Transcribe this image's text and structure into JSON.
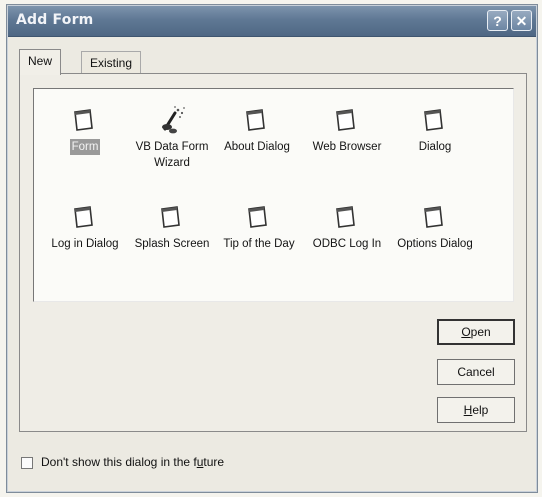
{
  "window": {
    "title": "Add Form",
    "help_glyph": "?",
    "close_glyph": "✕"
  },
  "tabs": [
    {
      "label": "New",
      "active": true
    },
    {
      "label": "Existing",
      "active": false
    }
  ],
  "items": [
    {
      "label": "Form",
      "icon": "form-icon",
      "selected": true
    },
    {
      "label": "VB Data Form Wizard",
      "icon": "wizard-icon",
      "selected": false
    },
    {
      "label": "About Dialog",
      "icon": "form-icon",
      "selected": false
    },
    {
      "label": "Web Browser",
      "icon": "form-icon",
      "selected": false
    },
    {
      "label": "Dialog",
      "icon": "form-icon",
      "selected": false
    },
    {
      "label": "Log in Dialog",
      "icon": "form-icon",
      "selected": false
    },
    {
      "label": "Splash Screen",
      "icon": "form-icon",
      "selected": false
    },
    {
      "label": "Tip of the Day",
      "icon": "form-icon",
      "selected": false
    },
    {
      "label": "ODBC Log In",
      "icon": "form-icon",
      "selected": false
    },
    {
      "label": "Options Dialog",
      "icon": "form-icon",
      "selected": false
    }
  ],
  "buttons": {
    "open": {
      "before": "",
      "mnemonic": "O",
      "after": "pen"
    },
    "cancel": "Cancel",
    "help": {
      "before": "",
      "mnemonic": "H",
      "after": "elp"
    }
  },
  "footer": {
    "checkbox_checked": false,
    "label_before": "Don't show this dialog in the f",
    "label_mnemonic": "u",
    "label_after": "ture"
  }
}
